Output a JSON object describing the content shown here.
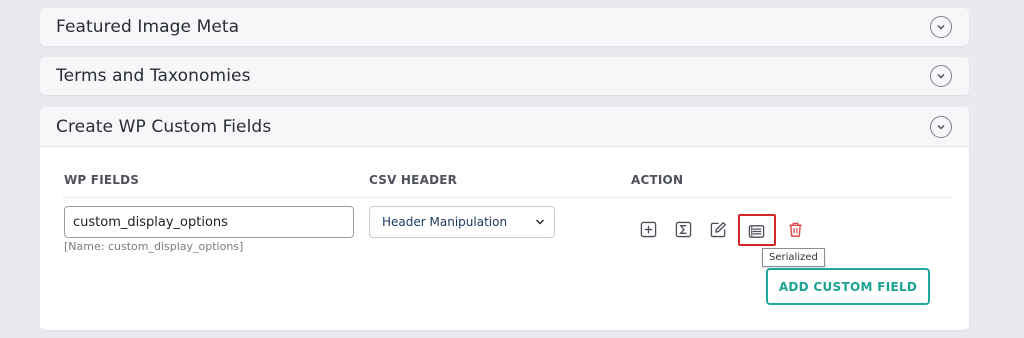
{
  "panels": {
    "featured": {
      "title": "Featured Image Meta"
    },
    "terms": {
      "title": "Terms and Taxonomies"
    },
    "custom": {
      "title": "Create WP Custom Fields",
      "columns": {
        "wp_fields": "WP FIELDS",
        "csv_header": "CSV HEADER",
        "action": "ACTION"
      },
      "row": {
        "field_value": "custom_display_options",
        "field_hint": "[Name: custom_display_options]",
        "csv_header_selected": "Header Manipulation"
      },
      "actions": {
        "add": "plus-square-icon",
        "formula": "sigma-icon",
        "edit": "edit-icon",
        "serialized": "serialized-list-icon",
        "delete": "trash-icon"
      },
      "tooltip": "Serialized",
      "add_button_label": "ADD CUSTOM FIELD"
    }
  },
  "colors": {
    "accent": "#1fa99a",
    "highlight": "#d42727",
    "delete": "#e14848"
  }
}
